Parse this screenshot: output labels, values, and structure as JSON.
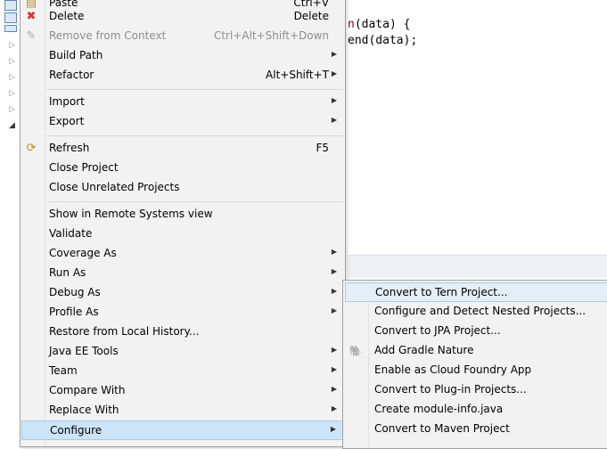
{
  "editor": {
    "line1": {
      "prefix": "n",
      "rest": "(data) {"
    },
    "line2": {
      "text": "end(data);"
    }
  },
  "menu": {
    "items": [
      {
        "label": "Paste",
        "shortcut": "Ctrl+V",
        "icon": "clipboard-icon"
      },
      {
        "label": "Delete",
        "shortcut": "Delete",
        "icon": "delete-x-icon",
        "icon_color": "#d9312a"
      },
      {
        "label": "Remove from Context",
        "shortcut": "Ctrl+Alt+Shift+Down",
        "icon": "remove-context-icon",
        "disabled": true
      },
      {
        "label": "Build Path",
        "submenu": true
      },
      {
        "label": "Refactor",
        "shortcut": "Alt+Shift+T",
        "submenu": true
      },
      {
        "label": "Import",
        "submenu": true
      },
      {
        "label": "Export",
        "submenu": true
      },
      {
        "label": "Refresh",
        "shortcut": "F5",
        "icon": "refresh-icon"
      },
      {
        "label": "Close Project"
      },
      {
        "label": "Close Unrelated Projects"
      },
      {
        "label": "Show in Remote Systems view"
      },
      {
        "label": "Validate"
      },
      {
        "label": "Coverage As",
        "submenu": true
      },
      {
        "label": "Run As",
        "submenu": true
      },
      {
        "label": "Debug As",
        "submenu": true
      },
      {
        "label": "Profile As",
        "submenu": true
      },
      {
        "label": "Restore from Local History..."
      },
      {
        "label": "Java EE Tools",
        "submenu": true
      },
      {
        "label": "Team",
        "submenu": true
      },
      {
        "label": "Compare With",
        "submenu": true
      },
      {
        "label": "Replace With",
        "submenu": true
      },
      {
        "label": "Configure",
        "submenu": true,
        "active": true
      }
    ]
  },
  "submenu": {
    "items": [
      {
        "label": "Convert to Tern Project..."
      },
      {
        "label": "Configure and Detect Nested Projects..."
      },
      {
        "label": "Convert to JPA Project..."
      },
      {
        "label": "Add Gradle Nature",
        "icon": "gradle-elephant-icon"
      },
      {
        "label": "Enable as Cloud Foundry App"
      },
      {
        "label": "Convert to Plug-in Projects..."
      },
      {
        "label": "Create module-info.java"
      },
      {
        "label": "Convert to Maven Project"
      }
    ]
  },
  "colors": {
    "menu_bg": "#f2f2f2",
    "active_bg": "#cce4f7",
    "keyword": "#7f0055"
  }
}
